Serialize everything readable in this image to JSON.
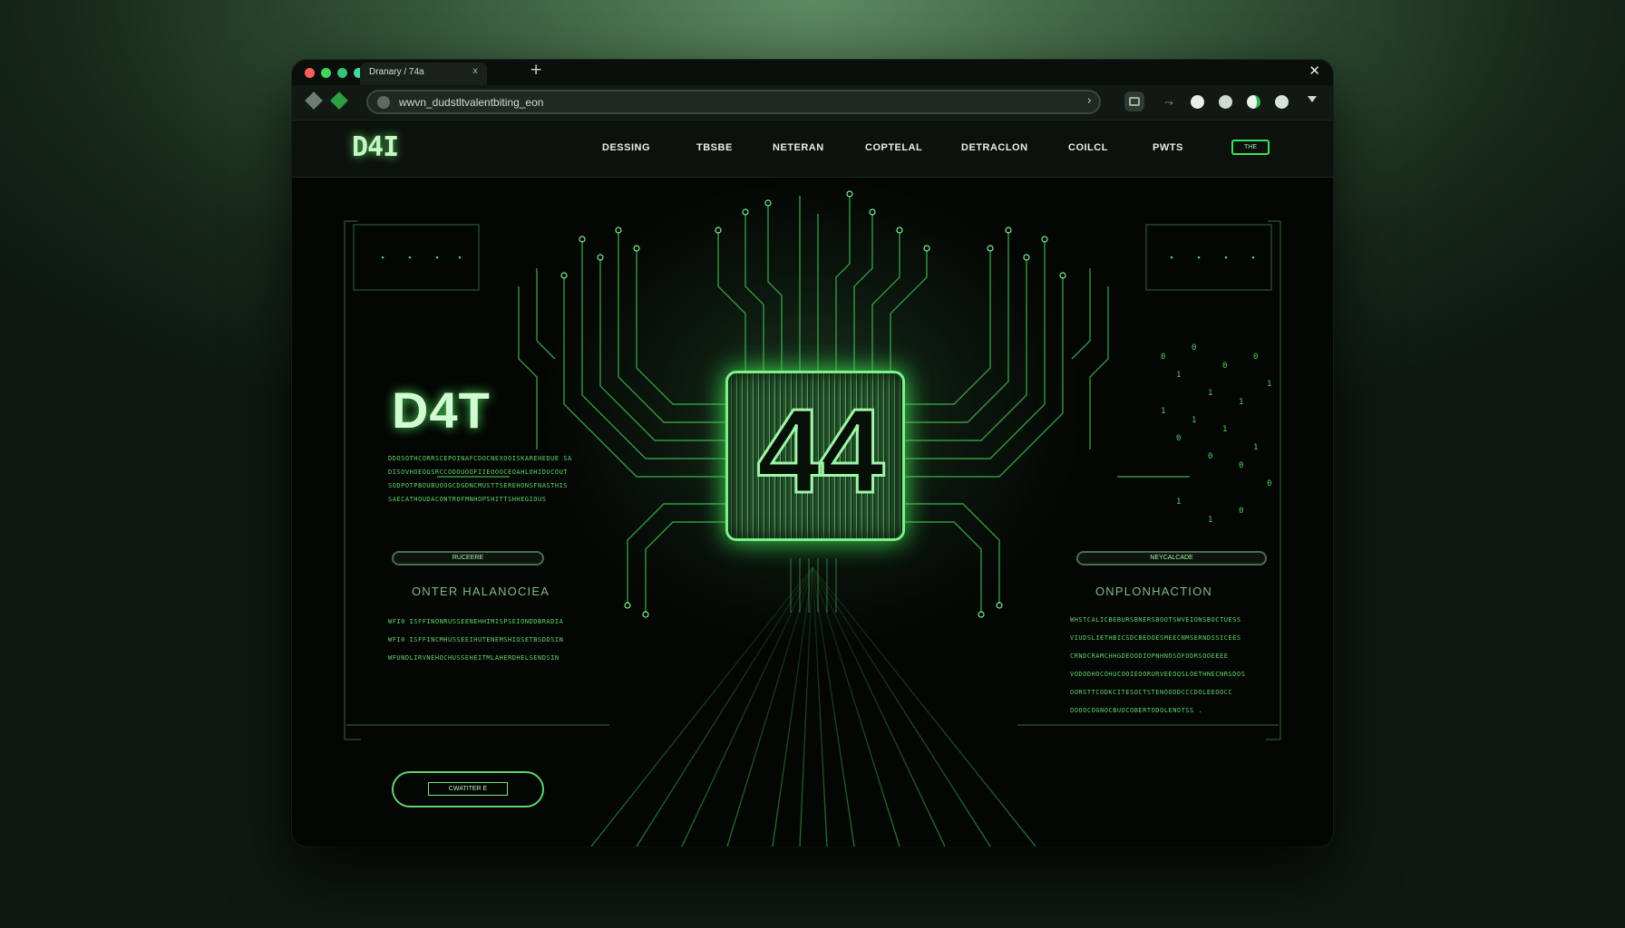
{
  "browser": {
    "tab_title": "Dranary / 74a",
    "tab_close": "x",
    "new_tab": "+",
    "close": "✕",
    "url": "wwvn_dudstltvalentbiting_eon",
    "url_go": "›"
  },
  "site": {
    "logo": "D4I",
    "nav": [
      "DESSING",
      "TBSBE",
      "NETERAN",
      "COPTELAL",
      "DETRACLON",
      "COILCL",
      "PWTS"
    ],
    "nav_button": "THE"
  },
  "hero": {
    "title": "D4T",
    "chip_text": "44",
    "left_lines": [
      "DDOSOTHCORRSCEPOINAFCDOCNEXOOISKAREHEDUE SA",
      "DISOVHOEOGSRCCODOUOOFIIEOOOCEOAHLOHIDUCOUT",
      "SODPOTPBOUBUOOGCDGDNCMUSTTSEREHONSFNASTHIS",
      "SAECATHOUDACONTROFMNHOPSHITTSHHEGIOUS"
    ],
    "left_pill": "RUCEERE",
    "left_section": "ONTER HALANOCIEA",
    "left_lines2": [
      "WFI0 ISFFINONRUSSEENEHHIMISPSEIONDDBRADIA",
      "WFI0 ISFFINCMHUSSEEIHUTENEMSHIOSETBSDDSIN",
      "WFUNDLIRVNEHOCHUSSEHEITMLAHERDHELSENDSIN"
    ],
    "cta": "CWATITER E",
    "right_pill": "NEYCALCADE",
    "right_section": "ONPLONHACTION",
    "right_lines": [
      "WHSTCALICBEBURSBNERSBOOTSWVEIONSBOCTUESS",
      "VIUDSLIETHBICSDCBEOOESMEECNMSERNDSSICEES",
      "CRNDCRAMCHHGDEOODIOPNHNOSOFODRSOOEEEE",
      "VODODHOCOHUCOOIEOORURVEEOQSLOETHNECNRSDOS",
      "OORSTTCODKCITESOCTSTENOODDCCCDOLEEOOCC",
      "OOOOCOGNOCBUOCOBERTODOLENOTSS ."
    ]
  },
  "colors": {
    "accent": "#4fe061",
    "background": "#050806",
    "traffic_red": "#ff5f57",
    "traffic_green": "#3fd45a",
    "traffic_green2": "#35c47b",
    "traffic_teal": "#44d9a0"
  },
  "icons": {
    "toolbar": [
      "back-icon",
      "extension-icon",
      "site-info-icon",
      "reader-icon",
      "share-icon",
      "account-icon",
      "sync-icon",
      "profile-icon",
      "menu-icon"
    ]
  }
}
